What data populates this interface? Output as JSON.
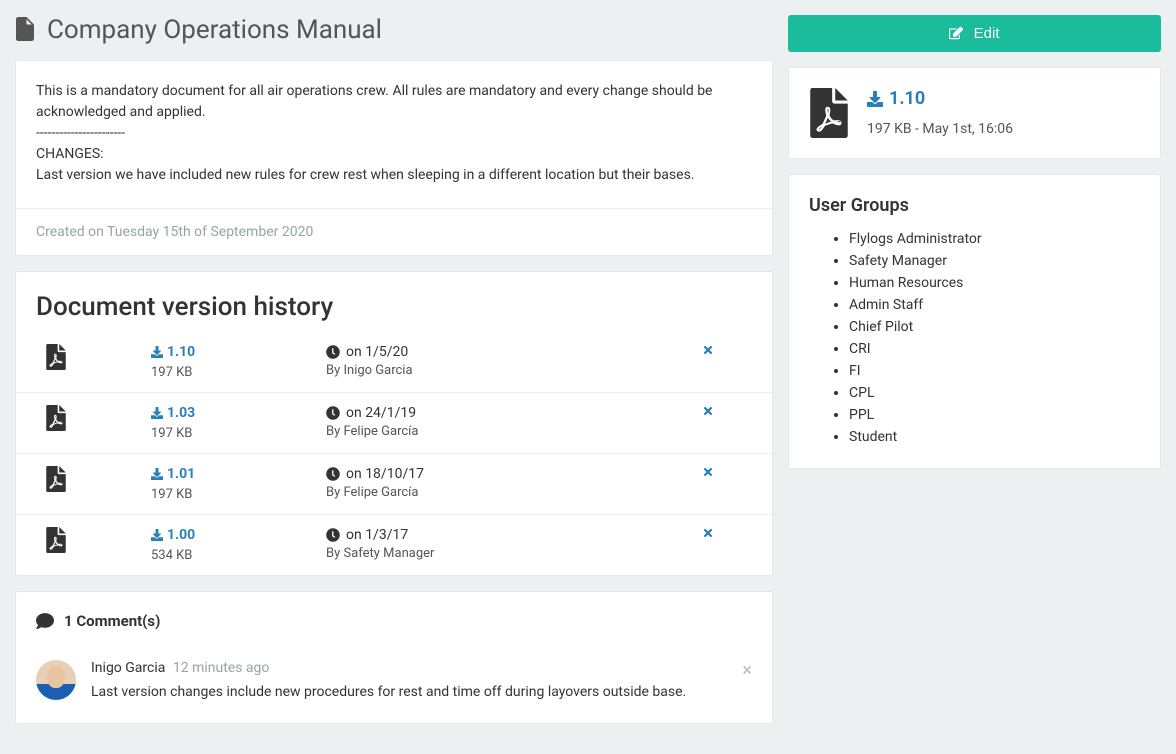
{
  "page_title": "Company Operations Manual",
  "description_lines": [
    "This is a mandatory document for all air operations crew. All rules are mandatory and every change should be acknowledged and applied.",
    "-----------------------",
    "CHANGES:",
    "Last version we have included new rules for crew rest when sleeping in a different location but their bases."
  ],
  "created_on": "Created on Tuesday 15th of September 2020",
  "history": {
    "title": "Document version history",
    "rows": [
      {
        "version": "1.10",
        "size": "197 KB",
        "date": "on 1/5/20",
        "by": "By Inigo Garcia"
      },
      {
        "version": "1.03",
        "size": "197 KB",
        "date": "on 24/1/19",
        "by": "By Felipe García"
      },
      {
        "version": "1.01",
        "size": "197 KB",
        "date": "on 18/10/17",
        "by": "By Felipe García"
      },
      {
        "version": "1.00",
        "size": "534 KB",
        "date": "on 1/3/17",
        "by": "By Safety Manager"
      }
    ]
  },
  "comments": {
    "title": "1 Comment(s)",
    "items": [
      {
        "author": "Inigo Garcia",
        "time": "12 minutes ago",
        "text": "Last version changes include new procedures for rest and time off during layovers outside base."
      }
    ]
  },
  "sidebar": {
    "edit_label": "Edit",
    "current_version": "1.10",
    "file_meta": "197 KB - May 1st, 16:06",
    "groups_title": "User Groups",
    "groups": [
      "Flylogs Administrator",
      "Safety Manager",
      "Human Resources",
      "Admin Staff",
      "Chief Pilot",
      "CRI",
      "FI",
      "CPL",
      "PPL",
      "Student"
    ]
  }
}
